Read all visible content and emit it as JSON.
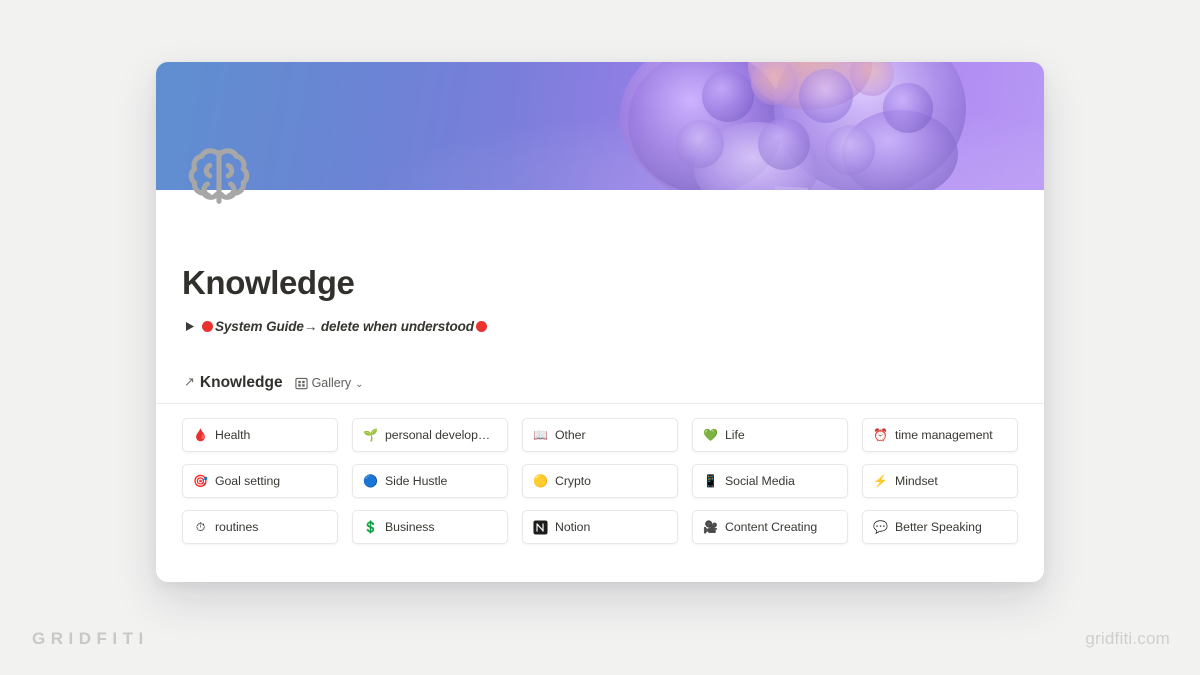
{
  "window": {
    "cover": {
      "name": "brain-cover-image",
      "gradient_from": "#5f8fd0",
      "gradient_to": "#b79bf0"
    },
    "page_icon": "brain-icon",
    "page_title": "Knowledge",
    "toggle": {
      "caret": "triangle-right-icon",
      "dot_color": "#e8332f",
      "text": "System Guide→ delete when understood"
    },
    "database": {
      "link_arrow": "↗",
      "title": "Knowledge",
      "view_icon": "gallery-view-icon",
      "view_label": "Gallery",
      "view_chevron": "⌄",
      "cards": [
        {
          "icon": "drop-of-blood-emoji",
          "glyph": "🩸",
          "label": "Health"
        },
        {
          "icon": "seedling-emoji",
          "glyph": "🌱",
          "label": "personal development"
        },
        {
          "icon": "open-book-emoji",
          "glyph": "📖",
          "label": "Other"
        },
        {
          "icon": "green-heart-emoji",
          "glyph": "💚",
          "label": "Life"
        },
        {
          "icon": "alarm-clock-emoji",
          "glyph": "⏰",
          "label": "time management"
        },
        {
          "icon": "dart-target-emoji",
          "glyph": "🎯",
          "label": "Goal setting"
        },
        {
          "icon": "blue-circle-emoji",
          "glyph": "🔵",
          "label": "Side Hustle"
        },
        {
          "icon": "yellow-circle-emoji",
          "glyph": "🟡",
          "label": "Crypto"
        },
        {
          "icon": "mobile-phone-emoji",
          "glyph": "📱",
          "label": "Social Media"
        },
        {
          "icon": "high-voltage-emoji",
          "glyph": "⚡",
          "label": "Mindset"
        },
        {
          "icon": "stopwatch-emoji",
          "glyph": "⏱",
          "label": "routines"
        },
        {
          "icon": "dollar-sign-emoji",
          "glyph": "💲",
          "label": "Business"
        },
        {
          "icon": "notion-logo-icon",
          "glyph": "N",
          "label": "Notion"
        },
        {
          "icon": "video-camera-emoji",
          "glyph": "🎥",
          "label": "Content Creating"
        },
        {
          "icon": "speech-balloon-emoji",
          "glyph": "💬",
          "label": "Better Speaking"
        }
      ]
    }
  },
  "watermarks": {
    "left": "GRIDFITI",
    "right": "gridfiti.com"
  }
}
